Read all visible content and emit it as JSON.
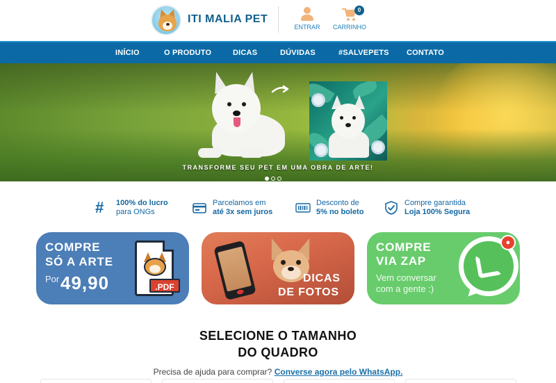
{
  "header": {
    "brand": "ITI MALIA PET",
    "login_label": "ENTRAR",
    "cart_label": "CARRINHO",
    "cart_count": "0",
    "colors": {
      "brand": "#11608d",
      "accent_icon": "#f2b47a"
    }
  },
  "nav": {
    "items": [
      "INÍCIO",
      "O PRODUTO",
      "DICAS",
      "DÚVIDAS",
      "#SALVEPETS",
      "CONTATO"
    ],
    "background": "#0b6aa6"
  },
  "hero": {
    "caption": "TRANSFORME SEU PET EM UMA OBRA DE ARTE!",
    "slides": 3,
    "active_slide": 1
  },
  "features": [
    {
      "icon": "hashtag-icon",
      "line1": "100% do lucro",
      "line2": "para ONGs"
    },
    {
      "icon": "card-icon",
      "line1": "Parcelamos em",
      "line2": "até 3x sem juros"
    },
    {
      "icon": "barcode-icon",
      "line1": "Desconto de",
      "line2": "5% no boleto"
    },
    {
      "icon": "shield-check-icon",
      "line1": "Compre garantida",
      "line2": "Loja 100% Segura"
    }
  ],
  "banners": {
    "arte": {
      "line1": "COMPRE",
      "line2": "SÓ A ARTE",
      "prefix": "Por",
      "price": "49,90",
      "tag": ".PDF",
      "color": "#4c7eb7"
    },
    "fotos": {
      "line1": "DICAS",
      "line2": "DE FOTOS"
    },
    "zap": {
      "line1": "COMPRE",
      "line2": "VIA ZAP",
      "sub1": "Vem conversar",
      "sub2": "com a gente :)",
      "color": "#68cc6c"
    }
  },
  "section": {
    "title_line1": "SELECIONE O TAMANHO",
    "title_line2": "DO QUADRO",
    "help_text": "Precisa de ajuda para comprar?",
    "help_link": "Converse agora pelo WhatsApp."
  }
}
